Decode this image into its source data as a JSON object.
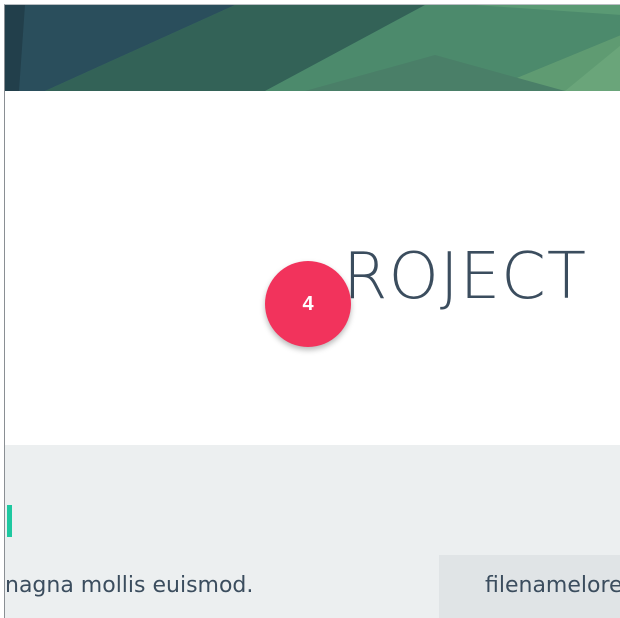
{
  "header": {
    "banner_colors": [
      "#2c4f5c",
      "#3a6b62",
      "#4b8a6c",
      "#5e9a73"
    ]
  },
  "hero": {
    "title": "ROJECT",
    "step_number": "4"
  },
  "content": {
    "body_text": "nagna mollis euismod.",
    "file_name": "filenamelore",
    "accent_color": "#1ec8a0"
  }
}
